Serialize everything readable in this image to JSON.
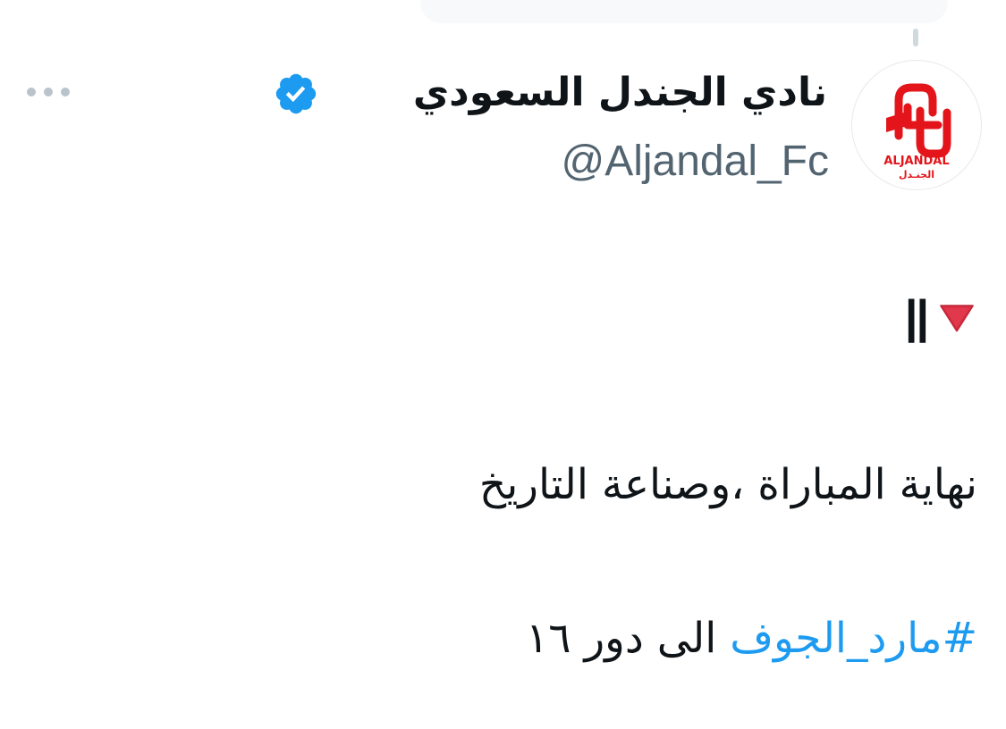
{
  "author": {
    "display_name": "نادي الجندل السعودي",
    "handle": "@Aljandal_Fc",
    "verified": true,
    "avatar_logo_text": "ALJANDAL",
    "avatar_logo_text_ar": "الجنـدل"
  },
  "tweet": {
    "line1_symbol": "||",
    "line1_emoji": "red-triangle-pointed-down",
    "line2": "نهاية المباراة ،وصناعة التاريخ",
    "hashtag": "#مارد_الجوف",
    "line3_rest": "الى دور ١٦"
  },
  "colors": {
    "link": "#1d9bf0",
    "verified_badge": "#1d9bf0",
    "text_primary": "#0f1419",
    "text_secondary": "#536471",
    "logo_red": "#e3151b"
  },
  "icons": {
    "more": "more-horizontal-icon",
    "verified": "verified-badge-icon",
    "triangle": "red-triangle-down-icon"
  }
}
